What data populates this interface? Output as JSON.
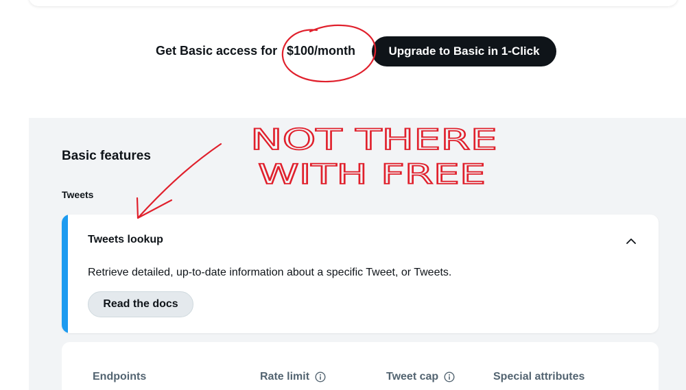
{
  "pricing": {
    "text": "Get Basic access for",
    "price": "$100/month",
    "upgrade_label": "Upgrade to Basic in 1-Click"
  },
  "features": {
    "title": "Basic features",
    "group_label": "Tweets",
    "card": {
      "title": "Tweets lookup",
      "description": "Retrieve detailed, up-to-date information about a specific Tweet, or Tweets.",
      "docs_label": "Read the docs"
    }
  },
  "table": {
    "headers": [
      "Endpoints",
      "Rate limit",
      "Tweet cap",
      "Special attributes"
    ]
  },
  "annotation": {
    "line1": "NOT THERE",
    "line2": "WITH FREE",
    "color": "#e0202c"
  },
  "colors": {
    "accent": "#1d9bf0",
    "dark_button": "#0f1419",
    "section_bg": "#f2f4f6"
  }
}
